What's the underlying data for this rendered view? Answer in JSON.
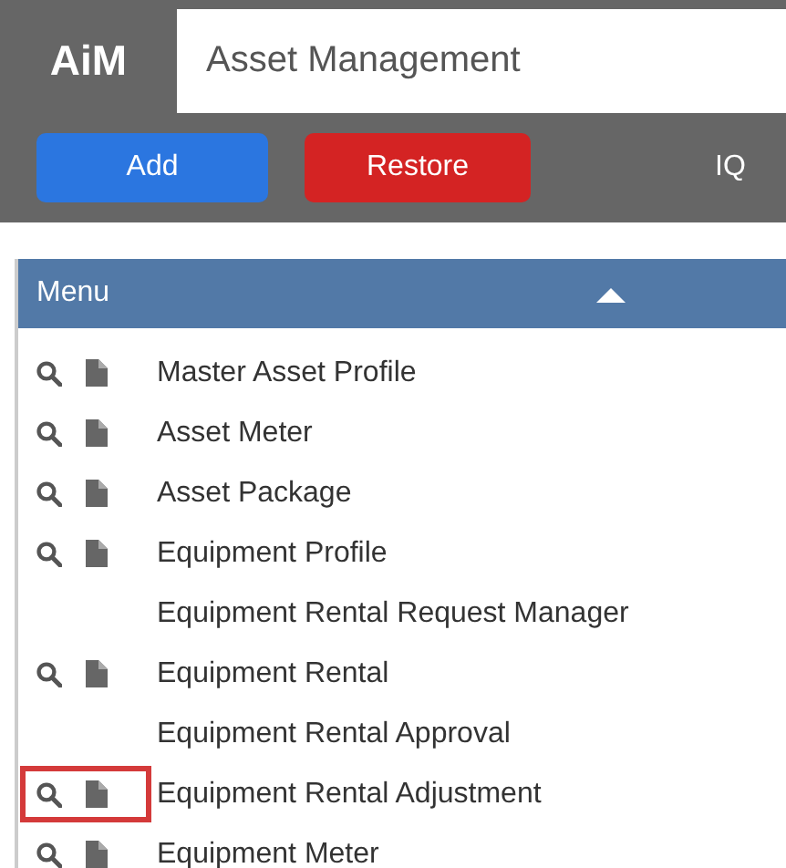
{
  "header": {
    "logo": "AiM",
    "title": "Asset Management"
  },
  "toolbar": {
    "buttons": [
      {
        "label": "Add",
        "kind": "add"
      },
      {
        "label": "Restore",
        "kind": "restore"
      },
      {
        "label": "IQ",
        "kind": "plain"
      }
    ]
  },
  "menu": {
    "title": "Menu",
    "expanded": true,
    "items": [
      {
        "label": "Master Asset Profile",
        "kind": "tools",
        "highlighted": false
      },
      {
        "label": "Asset Meter",
        "kind": "tools",
        "highlighted": false
      },
      {
        "label": "Asset Package",
        "kind": "tools",
        "highlighted": false
      },
      {
        "label": "Equipment Profile",
        "kind": "tools",
        "highlighted": false
      },
      {
        "label": "Equipment Rental Request Manager",
        "kind": "plain",
        "highlighted": false
      },
      {
        "label": "Equipment Rental",
        "kind": "tools",
        "highlighted": false
      },
      {
        "label": "Equipment Rental Approval",
        "kind": "plain",
        "highlighted": false
      },
      {
        "label": "Equipment Rental Adjustment",
        "kind": "tools",
        "highlighted": true
      },
      {
        "label": "Equipment Meter",
        "kind": "tools",
        "highlighted": false
      }
    ]
  }
}
